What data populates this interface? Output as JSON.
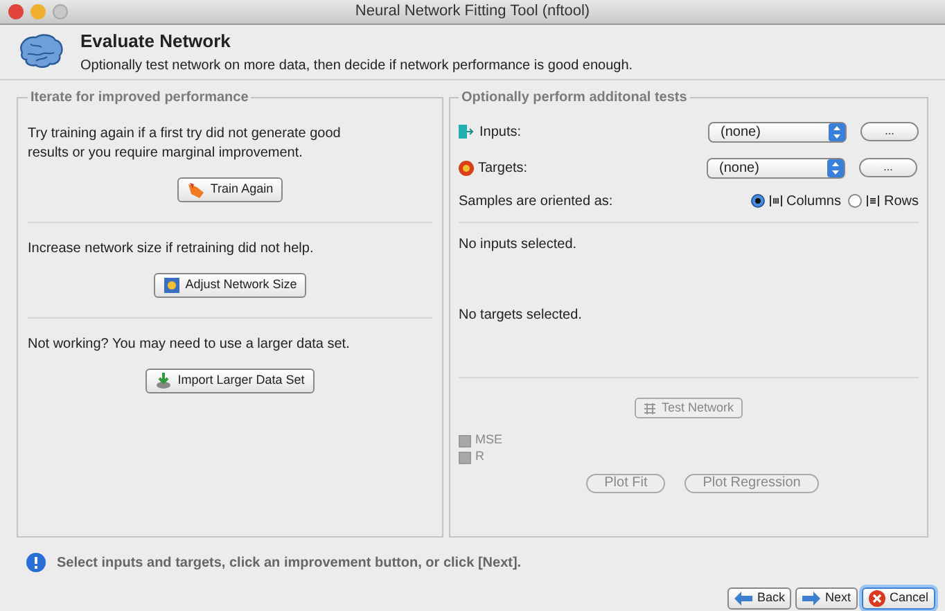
{
  "window": {
    "title": "Neural Network Fitting Tool (nftool)"
  },
  "header": {
    "title": "Evaluate Network",
    "subtitle": "Optionally test network on more data, then decide if network performance is good enough."
  },
  "left_panel": {
    "title": "Iterate for improved performance",
    "sections": [
      {
        "text": "Try training again if a first try did not generate good results or you require marginal improvement.",
        "button": {
          "kind": "train",
          "label": "Train Again"
        }
      },
      {
        "text": "Increase network size if retraining did not help.",
        "button": {
          "kind": "adjust",
          "label": "Adjust Network Size"
        }
      },
      {
        "text": "Not working? You may need to use a larger data set.",
        "button": {
          "kind": "import",
          "label": "Import Larger Data Set"
        }
      }
    ]
  },
  "right_panel": {
    "title": "Optionally perform additonal tests",
    "data_rows": [
      {
        "kind": "inputs",
        "label": "Inputs:",
        "value": "(none)",
        "browse": "..."
      },
      {
        "kind": "targets",
        "label": "Targets:",
        "value": "(none)",
        "browse": "..."
      }
    ],
    "orientation": {
      "label": "Samples are oriented as:",
      "options": [
        {
          "kind": "columns",
          "label": "Columns",
          "selected": true
        },
        {
          "kind": "rows",
          "label": "Rows",
          "selected": false
        }
      ]
    },
    "inputs_status": "No inputs selected.",
    "targets_status": "No targets selected.",
    "test_button": {
      "label": "Test Network",
      "disabled": true
    },
    "checks": [
      {
        "label": "MSE",
        "checked": false,
        "disabled": true
      },
      {
        "label": "R",
        "checked": false,
        "disabled": true
      }
    ],
    "plot_buttons": [
      {
        "label": "Plot Fit",
        "disabled": true
      },
      {
        "label": "Plot Regression",
        "disabled": true
      }
    ]
  },
  "status": "Select inputs and targets, click an improvement button, or click [Next].",
  "nav_buttons": [
    {
      "kind": "back",
      "label": "Back",
      "default": false
    },
    {
      "kind": "next",
      "label": "Next",
      "default": false
    },
    {
      "kind": "cancel",
      "label": "Cancel",
      "default": true
    }
  ]
}
